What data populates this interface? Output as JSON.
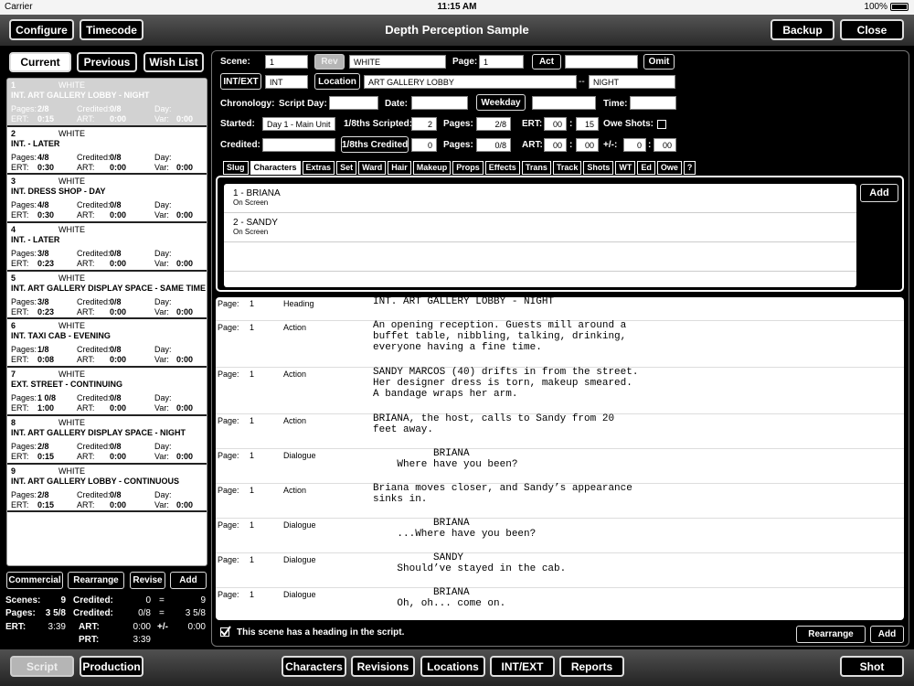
{
  "status": {
    "carrier": "Carrier",
    "time": "11:15 AM",
    "battery": "100%"
  },
  "header": {
    "title": "Depth Perception Sample",
    "configure": "Configure",
    "timecode": "Timecode",
    "backup": "Backup",
    "close": "Close"
  },
  "list_tabs": {
    "current": "Current",
    "previous": "Previous",
    "wish": "Wish List"
  },
  "scene_labels": {
    "pages": "Pages:",
    "credited": "Credited:",
    "day": "Day:",
    "ert": "ERT:",
    "art": "ART:",
    "var": "Var:"
  },
  "scenes": [
    {
      "num": "1",
      "rev": "WHITE",
      "heading": "INT. ART GALLERY LOBBY - NIGHT",
      "pages": "2/8",
      "credited": "0/8",
      "day": "",
      "ert": "0:15",
      "art": "0:00",
      "var": "0:00"
    },
    {
      "num": "2",
      "rev": "WHITE",
      "heading": "INT.  - LATER",
      "pages": "4/8",
      "credited": "0/8",
      "day": "",
      "ert": "0:30",
      "art": "0:00",
      "var": "0:00"
    },
    {
      "num": "3",
      "rev": "WHITE",
      "heading": "INT. DRESS SHOP - DAY",
      "pages": "4/8",
      "credited": "0/8",
      "day": "",
      "ert": "0:30",
      "art": "0:00",
      "var": "0:00"
    },
    {
      "num": "4",
      "rev": "WHITE",
      "heading": "INT.  - LATER",
      "pages": "3/8",
      "credited": "0/8",
      "day": "",
      "ert": "0:23",
      "art": "0:00",
      "var": "0:00"
    },
    {
      "num": "5",
      "rev": "WHITE",
      "heading": "INT. ART GALLERY DISPLAY SPACE - SAME TIME",
      "pages": "3/8",
      "credited": "0/8",
      "day": "",
      "ert": "0:23",
      "art": "0:00",
      "var": "0:00"
    },
    {
      "num": "6",
      "rev": "WHITE",
      "heading": "INT. TAXI CAB - EVENING",
      "pages": "1/8",
      "credited": "0/8",
      "day": "",
      "ert": "0:08",
      "art": "0:00",
      "var": "0:00"
    },
    {
      "num": "7",
      "rev": "WHITE",
      "heading": "EXT. STREET - CONTINUING",
      "pages": "1 0/8",
      "credited": "0/8",
      "day": "",
      "ert": "1:00",
      "art": "0:00",
      "var": "0:00"
    },
    {
      "num": "8",
      "rev": "WHITE",
      "heading": "INT. ART GALLERY DISPLAY SPACE - NIGHT",
      "pages": "2/8",
      "credited": "0/8",
      "day": "",
      "ert": "0:15",
      "art": "0:00",
      "var": "0:00"
    },
    {
      "num": "9",
      "rev": "WHITE",
      "heading": "INT. ART GALLERY LOBBY - CONTINUOUS",
      "pages": "2/8",
      "credited": "0/8",
      "day": "",
      "ert": "0:15",
      "art": "0:00",
      "var": "0:00"
    }
  ],
  "list_actions": {
    "commercial": "Commercial",
    "rearrange": "Rearrange",
    "revise": "Revise",
    "add": "Add"
  },
  "totals": {
    "scenes_label": "Scenes:",
    "scenes": "9",
    "credited1_label": "Credited:",
    "credited1": "0",
    "eq1": "=",
    "res1": "9",
    "pages_label": "Pages:",
    "pages": "3 5/8",
    "credited2_label": "Credited:",
    "credited2": "0/8",
    "eq2": "=",
    "res2": "3 5/8",
    "ert_label": "ERT:",
    "ert": "3:39",
    "art_label": "ART:",
    "art": "0:00",
    "pm_label": "+/-",
    "pm": "0:00",
    "prt_label": "PRT:",
    "prt": "3:39"
  },
  "form": {
    "scene_label": "Scene:",
    "scene": "1",
    "rev_btn": "Rev",
    "rev": "WHITE",
    "page_label": "Page:",
    "page": "1",
    "act_btn": "Act",
    "act": "",
    "omit_btn": "Omit",
    "intext_btn": "INT/EXT",
    "intext": "INT",
    "location_btn": "Location",
    "location": "ART GALLERY LOBBY",
    "dash": "--",
    "time_of_day": "NIGHT",
    "chronology_label": "Chronology:",
    "scriptday_label": "Script Day:",
    "scriptday": "",
    "date_label": "Date:",
    "date": "",
    "weekday_btn": "Weekday",
    "weekday": "",
    "time_label": "Time:",
    "time": "",
    "started_label": "Started:",
    "started": "Day 1 - Main Unit",
    "eighths_label": "1/8ths Scripted:",
    "eighths": "2",
    "pages_label": "Pages:",
    "pages": "2/8",
    "ert_label": "ERT:",
    "ert_h": "00",
    "colon1": ":",
    "ert_m": "15",
    "owe_label": "Owe Shots:",
    "credited_label": "Credited:",
    "credited": "",
    "eighths_credited_btn": "1/8ths Credited",
    "eighths_credited": "0",
    "pages2_label": "Pages:",
    "pages2": "0/8",
    "art_label": "ART:",
    "art_h": "00",
    "colon2": ":",
    "art_m": "00",
    "pm_label": "+/-:",
    "pm_h": "0",
    "colon3": ":",
    "pm_m": "00"
  },
  "tabs": [
    "Slug",
    "Characters",
    "Extras",
    "Set",
    "Ward",
    "Hair",
    "Makeup",
    "Props",
    "Effects",
    "Trans",
    "Track",
    "Shots",
    "WT",
    "Ed",
    "Owe",
    "?"
  ],
  "characters": [
    {
      "name": "1 - BRIANA",
      "status": "On Screen"
    },
    {
      "name": "2 - SANDY",
      "status": "On Screen"
    }
  ],
  "char_add": "Add",
  "script_page_label": "Page:",
  "script_lines": [
    {
      "page": "1",
      "type": "Heading",
      "text": "INT. ART GALLERY LOBBY - NIGHT"
    },
    {
      "page": "1",
      "type": "Action",
      "text": "An opening reception. Guests mill around a\nbuffet table, nibbling, talking, drinking,\neveryone having a fine time."
    },
    {
      "page": "1",
      "type": "Action",
      "text": "SANDY MARCOS (40) drifts in from the street.\nHer designer dress is torn, makeup smeared.\nA bandage wraps her arm."
    },
    {
      "page": "1",
      "type": "Action",
      "text": "BRIANA, the host, calls to Sandy from 20\nfeet away."
    },
    {
      "page": "1",
      "type": "Dialogue",
      "text": "          BRIANA\n    Where have you been?"
    },
    {
      "page": "1",
      "type": "Action",
      "text": "Briana moves closer, and Sandy’s appearance\nsinks in."
    },
    {
      "page": "1",
      "type": "Dialogue",
      "text": "          BRIANA\n    ...Where have you been?"
    },
    {
      "page": "1",
      "type": "Dialogue",
      "text": "          SANDY\n    Should’ve stayed in the cab."
    },
    {
      "page": "1",
      "type": "Dialogue",
      "text": "          BRIANA\n    Oh, oh... come on."
    }
  ],
  "heading_note": "This scene has a heading in the script.",
  "script_actions": {
    "rearrange": "Rearrange",
    "add": "Add"
  },
  "bottom": {
    "script": "Script",
    "production": "Production",
    "characters": "Characters",
    "revisions": "Revisions",
    "locations": "Locations",
    "intext": "INT/EXT",
    "reports": "Reports",
    "shot": "Shot"
  }
}
